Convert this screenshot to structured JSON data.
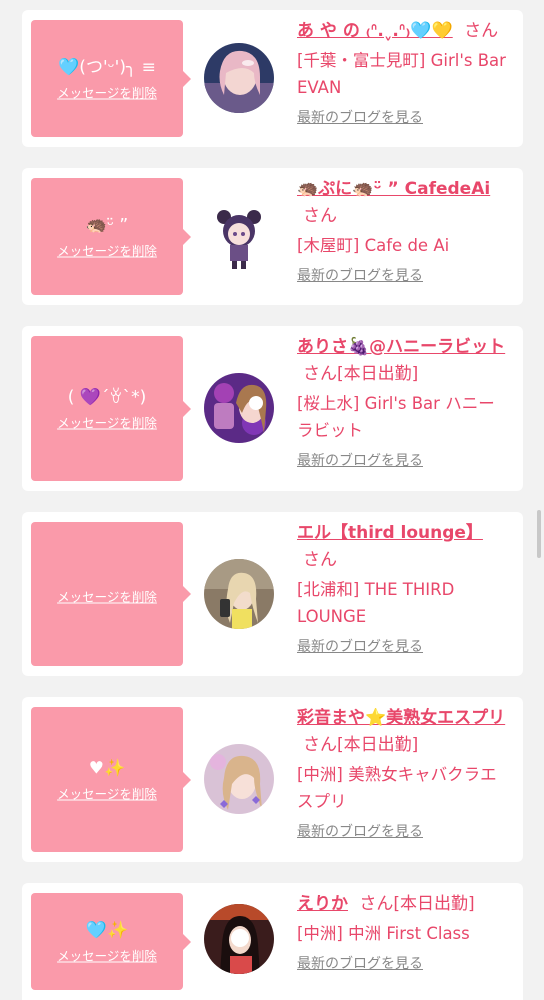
{
  "entries": [
    {
      "message": "🩵(つ'ᵕ')╮ ≡",
      "delete_label": "メッセージを削除",
      "name": "あ や の ₍ᐢ.ˬ.ᐢ₎🩵💛",
      "honorific": "さん",
      "shop": "[千葉・富士見町] Girl's Bar EVAN",
      "blog_link": "最新のブログを見る"
    },
    {
      "message": "🦔ᵕ̈ ”",
      "delete_label": "メッセージを削除",
      "name": "🦔ぷに🦔ᵕ̈ ” CafedeAi",
      "honorific": "さん",
      "shop": "[木屋町] Cafe de Ai",
      "blog_link": "最新のブログを見る"
    },
    {
      "message": "( 💜´ꈊ`*)",
      "delete_label": "メッセージを削除",
      "name": "ありさ🍇@ハニーラビット",
      "honorific": "さん[本日出勤]",
      "shop": "[桜上水] Girl's Bar ハニーラビット",
      "blog_link": "最新のブログを見る"
    },
    {
      "message": "",
      "delete_label": "メッセージを削除",
      "name": "エル【third lounge】",
      "honorific": "さん",
      "shop": "[北浦和] THE THIRD LOUNGE",
      "blog_link": "最新のブログを見る"
    },
    {
      "message": "♥✨",
      "delete_label": "メッセージを削除",
      "name": "彩音まや⭐美熟女エスプリ",
      "honorific": "さん[本日出勤]",
      "shop": "[中洲] 美熟女キャバクラエスプリ",
      "blog_link": "最新のブログを見る"
    },
    {
      "message": "🩵✨",
      "delete_label": "メッセージを削除",
      "name": "えりか",
      "honorific": "さん[本日出勤]",
      "shop": "[中洲] 中洲 First Class",
      "blog_link": "最新のブログを見る"
    }
  ],
  "colors": {
    "accent": "#e8476a",
    "bubble": "#fa9aaa",
    "background": "#f2f2f2",
    "link_gray": "#888888"
  }
}
